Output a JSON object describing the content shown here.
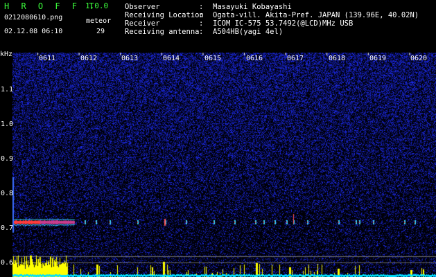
{
  "header": {
    "app_name": "H R O F F T",
    "version": "1.0.0",
    "filename": "0212080610.png",
    "datetime": "02.12.08 06:10",
    "meteor_label": "meteor",
    "meteor_count": "29",
    "fields": [
      {
        "key": "Observer",
        "value": "Masayuki Kobayashi"
      },
      {
        "key": "Receiving Location",
        "value": "Ogata-vill. Akita-Pref. JAPAN (139.96E, 40.02N)"
      },
      {
        "key": "Receiver",
        "value": "ICOM IC-575 53.7492(@LCD)MHz USB"
      },
      {
        "key": "Receiving antenna",
        "value": "A504HB(yagi 4el)"
      }
    ],
    "separator": ":"
  },
  "spectrogram": {
    "y_unit": "kHz",
    "y_ticks": [
      "1.1",
      "1.0",
      "0.9",
      "0.8",
      "0.7",
      "0.6"
    ],
    "x_ticks": [
      "0611",
      "0612",
      "0613",
      "0614",
      "0615",
      "0616",
      "0617",
      "0618",
      "0619",
      "0620"
    ],
    "colors": {
      "background": "#000000",
      "noise": "#1a28c8",
      "echo": "#ff4040",
      "histogram": "#ffff00",
      "baseline": "#00e0ff",
      "tick": "#ffffff"
    }
  }
}
